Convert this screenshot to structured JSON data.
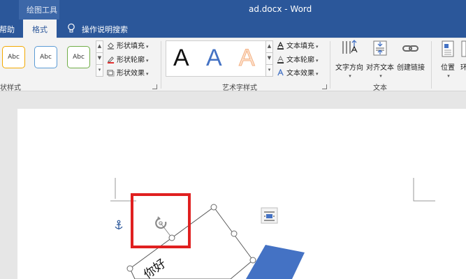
{
  "title_bar": {
    "contextual_group": "绘图工具",
    "document_title": "ad.docx  -  Word"
  },
  "tabs": {
    "help": "帮助",
    "format": "格式",
    "tell_me": "操作说明搜索"
  },
  "ribbon": {
    "shape_styles": {
      "label": "状样式",
      "presets": [
        {
          "text": "Abc",
          "color": "#f2a900"
        },
        {
          "text": "Abc",
          "color": "#5b9bd5"
        },
        {
          "text": "Abc",
          "color": "#70ad47"
        }
      ],
      "fill": "形状填充",
      "outline": "形状轮廓",
      "effects": "形状效果"
    },
    "wordart_styles": {
      "label": "艺术字样式",
      "samples": [
        {
          "text": "A",
          "color": "#111111"
        },
        {
          "text": "A",
          "color": "#4472c4"
        },
        {
          "text": "A",
          "color": "#f4b183"
        }
      ],
      "text_fill": "文本填充",
      "text_outline": "文本轮廓",
      "text_effects": "文本效果"
    },
    "text_group": {
      "label": "文本",
      "direction": "文字方向",
      "align": "对齐文本",
      "link": "创建链接"
    },
    "arrange": {
      "position": "位置",
      "partial": "环"
    }
  },
  "document": {
    "textbox_text": "你好"
  },
  "colors": {
    "title_blue": "#2b579a",
    "highlight_red": "#e02020",
    "arrow_blue": "#4472c4"
  }
}
